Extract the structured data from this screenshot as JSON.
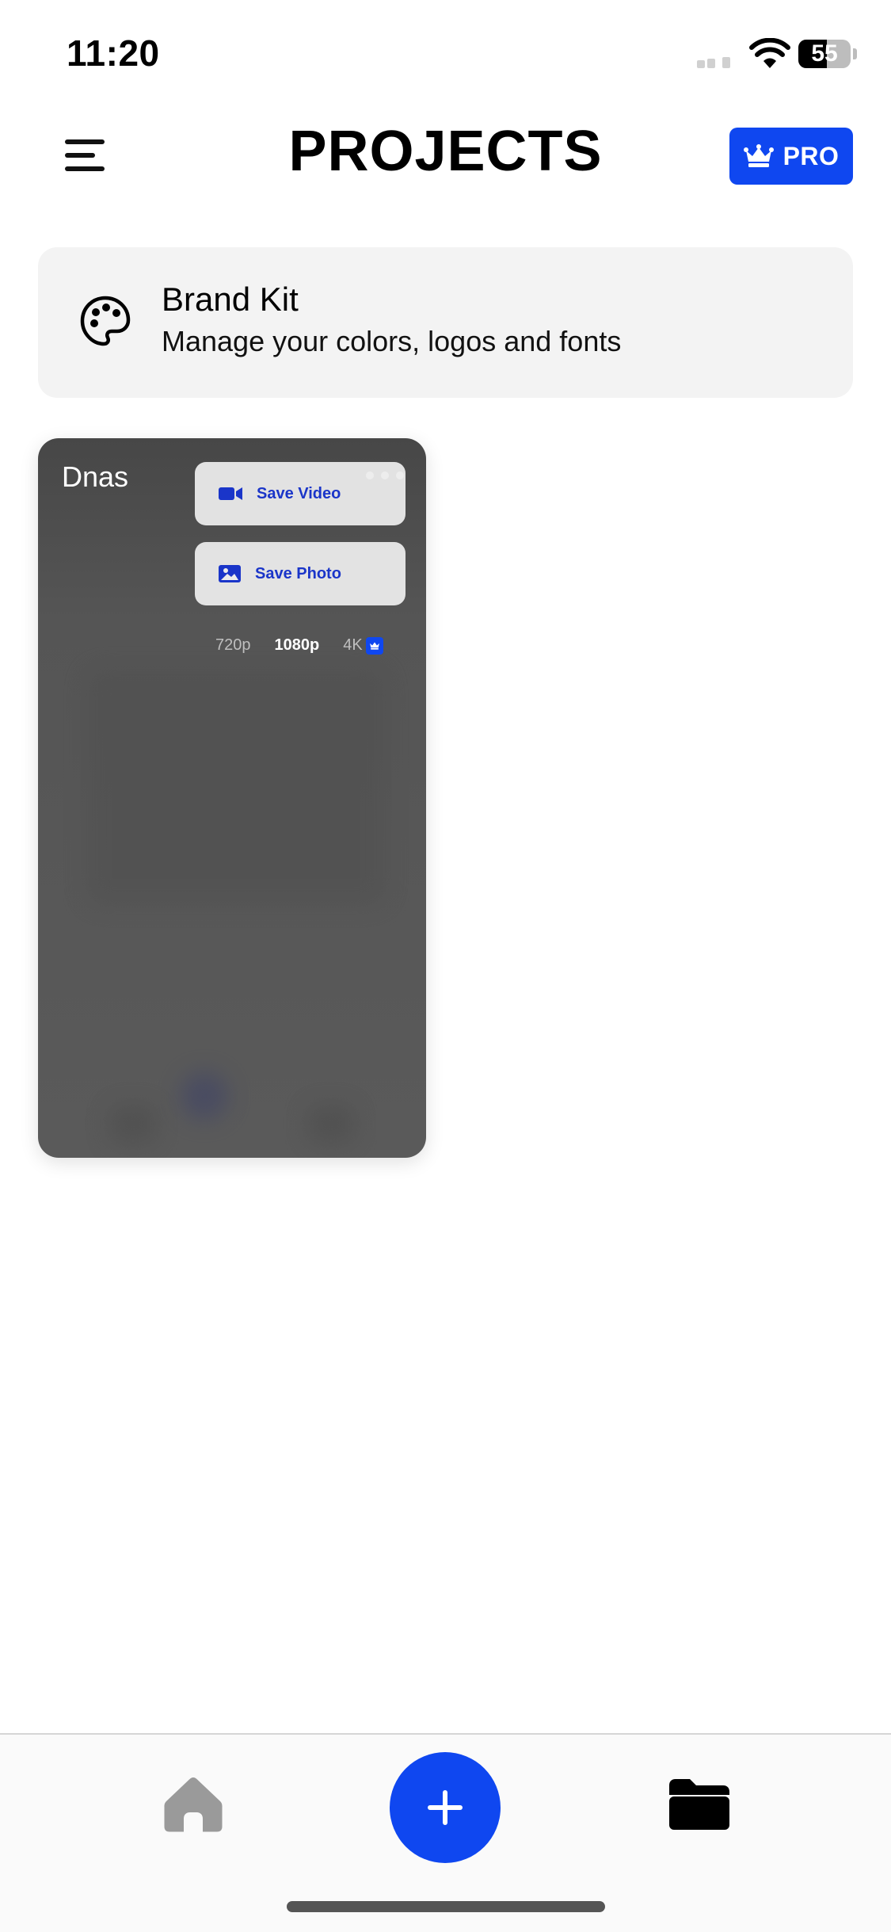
{
  "status_bar": {
    "time": "11:20",
    "battery_percent": 55,
    "battery_label": "55",
    "icons": [
      "cellular-signal-icon",
      "wifi-icon",
      "battery-icon"
    ]
  },
  "header": {
    "title": "PROJECTS",
    "menu_icon": "hamburger-menu-icon",
    "pro_button": {
      "label": "PRO",
      "icon": "crown-icon",
      "color": "#0f47f0"
    }
  },
  "brand_kit": {
    "title": "Brand Kit",
    "subtitle": "Manage your colors, logos and fonts",
    "icon": "palette-icon"
  },
  "projects": [
    {
      "name": "Dnas",
      "more_icon": "more-dots-icon",
      "export_menu": {
        "save_video_label": "Save Video",
        "save_photo_label": "Save Photo",
        "resolutions": [
          "720p",
          "1080p",
          "4K"
        ],
        "selected_resolution": "1080p",
        "pro_only_resolution": "4K"
      }
    }
  ],
  "tab_bar": {
    "items": [
      "home-icon",
      "add-icon",
      "folder-icon"
    ],
    "active": "folder-icon",
    "accent": "#0f47f0"
  }
}
